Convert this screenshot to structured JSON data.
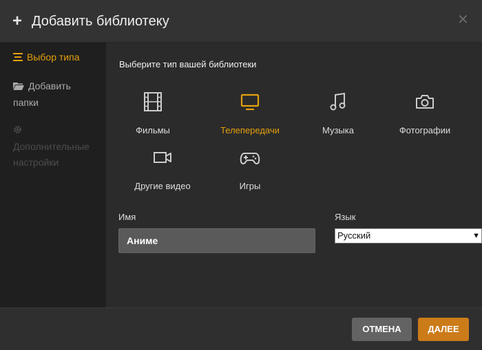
{
  "header": {
    "plus_icon": "plus-icon",
    "title": "Добавить библиотеку",
    "close_icon": "close-icon"
  },
  "sidebar": {
    "items": [
      {
        "label": "Выбор типа",
        "icon": "list-icon",
        "state": "active"
      },
      {
        "label_line1": "Добавить",
        "label_line2": "папки",
        "icon": "folder-icon",
        "state": "normal"
      },
      {
        "label_line1": "Дополнительные",
        "label_line2": "настройки",
        "icon": "gear-icon",
        "state": "disabled"
      }
    ]
  },
  "main": {
    "prompt": "Выберите тип вашей библиотеки",
    "types": [
      {
        "label": "Фильмы",
        "icon": "film-icon",
        "selected": false
      },
      {
        "label": "Телепередачи",
        "icon": "tv-icon",
        "selected": true
      },
      {
        "label": "Музыка",
        "icon": "music-icon",
        "selected": false
      },
      {
        "label": "Фотографии",
        "icon": "camera-icon",
        "selected": false
      },
      {
        "label": "Другие видео",
        "icon": "video-camera-icon",
        "selected": false
      },
      {
        "label": "Игры",
        "icon": "gamepad-icon",
        "selected": false
      }
    ],
    "name_field": {
      "label": "Имя",
      "value": "Аниме"
    },
    "language_field": {
      "label": "Язык",
      "selected": "Русский"
    }
  },
  "footer": {
    "cancel_label": "ОТМЕНА",
    "next_label": "ДАЛЕЕ"
  },
  "colors": {
    "accent": "#e5a00d",
    "next_button": "#cc7b19",
    "cancel_button": "#636363"
  }
}
